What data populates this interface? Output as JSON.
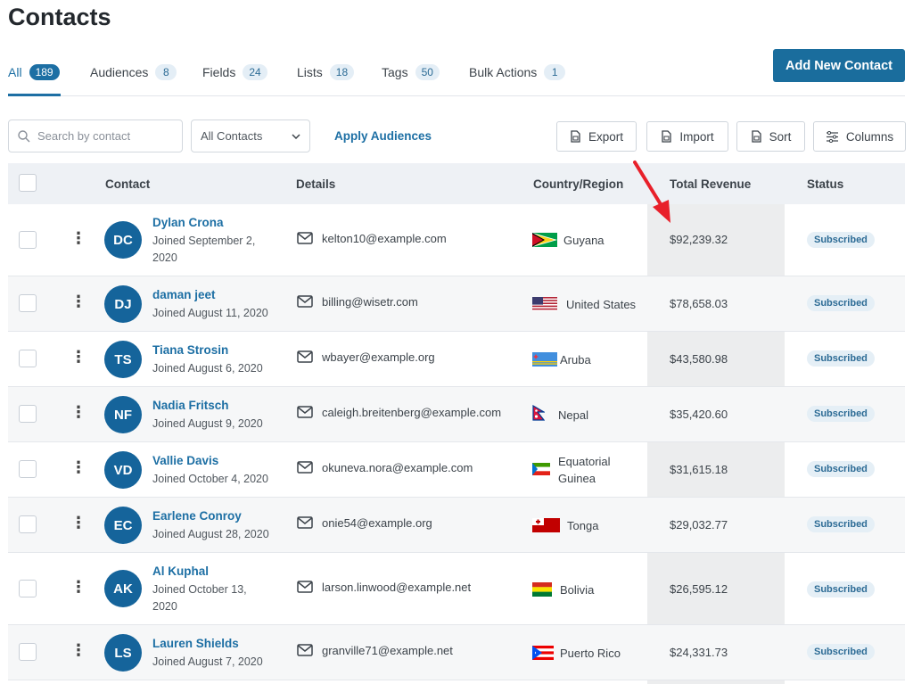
{
  "page": {
    "title": "Contacts"
  },
  "tabs": [
    {
      "label": "All",
      "count": "189"
    },
    {
      "label": "Audiences",
      "count": "8"
    },
    {
      "label": "Fields",
      "count": "24"
    },
    {
      "label": "Lists",
      "count": "18"
    },
    {
      "label": "Tags",
      "count": "50"
    },
    {
      "label": "Bulk Actions",
      "count": "1"
    }
  ],
  "actions": {
    "add_new": "Add New Contact"
  },
  "filters": {
    "search_placeholder": "Search by contact",
    "audience_select": "All Contacts",
    "apply": "Apply Audiences"
  },
  "toolbar": {
    "export": "Export",
    "import": "Import",
    "sort": "Sort",
    "columns": "Columns"
  },
  "table": {
    "headers": {
      "contact": "Contact",
      "details": "Details",
      "country": "Country/Region",
      "revenue": "Total Revenue",
      "status": "Status"
    },
    "rows": [
      {
        "initials": "DC",
        "name": "Dylan Crona",
        "joined": "Joined September 2, 2020",
        "email": "kelton10@example.com",
        "country": "Guyana",
        "revenue": "$92,239.32",
        "status": "Subscribed"
      },
      {
        "initials": "DJ",
        "name": "daman jeet",
        "joined": "Joined August 11, 2020",
        "email": "billing@wisetr.com",
        "country": "United States",
        "revenue": "$78,658.03",
        "status": "Subscribed"
      },
      {
        "initials": "TS",
        "name": "Tiana Strosin",
        "joined": "Joined August 6, 2020",
        "email": "wbayer@example.org",
        "country": "Aruba",
        "revenue": "$43,580.98",
        "status": "Subscribed"
      },
      {
        "initials": "NF",
        "name": "Nadia Fritsch",
        "joined": "Joined August 9, 2020",
        "email": "caleigh.breitenberg@example.com",
        "country": "Nepal",
        "revenue": "$35,420.60",
        "status": "Subscribed"
      },
      {
        "initials": "VD",
        "name": "Vallie Davis",
        "joined": "Joined October 4, 2020",
        "email": "okuneva.nora@example.com",
        "country": "Equatorial Guinea",
        "revenue": "$31,615.18",
        "status": "Subscribed"
      },
      {
        "initials": "EC",
        "name": "Earlene Conroy",
        "joined": "Joined August 28, 2020",
        "email": "onie54@example.org",
        "country": "Tonga",
        "revenue": "$29,032.77",
        "status": "Subscribed"
      },
      {
        "initials": "AK",
        "name": "Al Kuphal",
        "joined": "Joined October 13, 2020",
        "email": "larson.linwood@example.net",
        "country": "Bolivia",
        "revenue": "$26,595.12",
        "status": "Subscribed"
      },
      {
        "initials": "LS",
        "name": "Lauren Shields",
        "joined": "Joined August 7, 2020",
        "email": "granville71@example.net",
        "country": "Puerto Rico",
        "revenue": "$24,331.73",
        "status": "Subscribed"
      }
    ]
  },
  "colors": {
    "accent": "#1d6fa4",
    "avatar": "#15649b",
    "arrow": "#e8202a"
  },
  "icons": [
    "search-icon",
    "chevron-down-icon",
    "export-icon",
    "import-icon",
    "sort-icon",
    "columns-icon",
    "kebab-icon",
    "mail-icon",
    "flag-icon",
    "arrow-annotation"
  ]
}
